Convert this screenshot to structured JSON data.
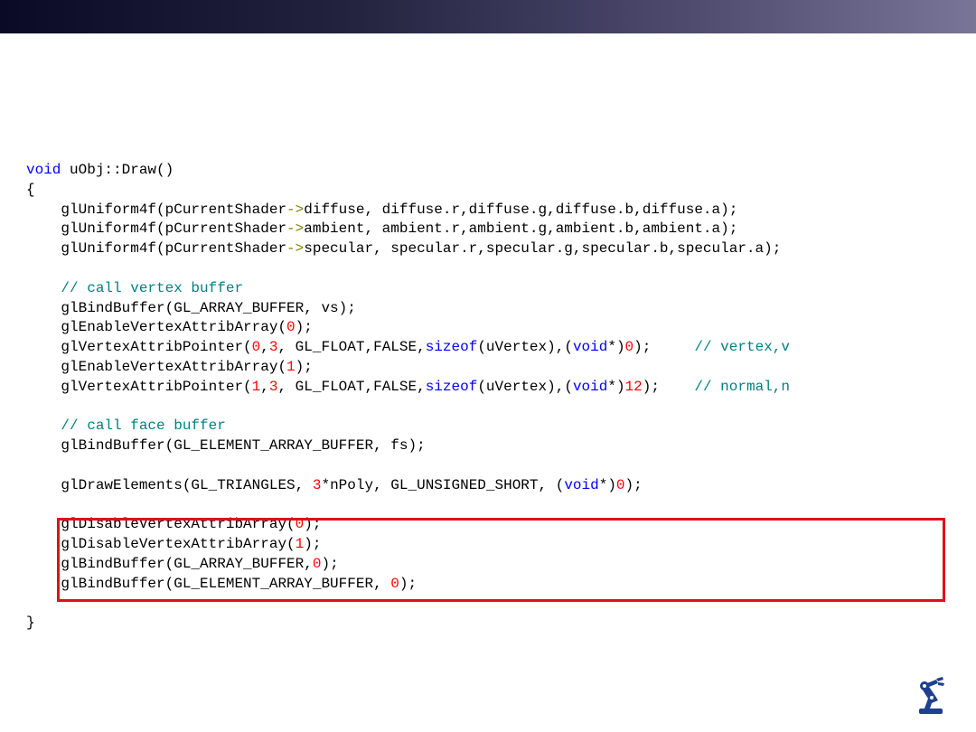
{
  "slide": {
    "colors": {
      "title_bar_start": "#0a0a26",
      "title_bar_end": "#787597",
      "highlight": "#e0101a"
    },
    "logo_icon": "robot-arm-icon"
  },
  "code": {
    "lines": [
      [
        {
          "t": "void",
          "c": "kw"
        },
        {
          "t": " uObj::Draw()"
        }
      ],
      [
        {
          "t": "{"
        }
      ],
      [
        {
          "t": "    glUniform4f(pCurrentShader"
        },
        {
          "t": "->",
          "c": "op"
        },
        {
          "t": "diffuse, diffuse.r,diffuse.g,diffuse.b,diffuse.a);"
        }
      ],
      [
        {
          "t": "    glUniform4f(pCurrentShader"
        },
        {
          "t": "->",
          "c": "op"
        },
        {
          "t": "ambient, ambient.r,ambient.g,ambient.b,ambient.a);"
        }
      ],
      [
        {
          "t": "    glUniform4f(pCurrentShader"
        },
        {
          "t": "->",
          "c": "op"
        },
        {
          "t": "specular, specular.r,specular.g,specular.b,specular.a);"
        }
      ],
      [],
      [
        {
          "t": "    "
        },
        {
          "t": "// call vertex buffer",
          "c": "cm"
        }
      ],
      [
        {
          "t": "    glBindBuffer(GL_ARRAY_BUFFER, vs);"
        }
      ],
      [
        {
          "t": "    glEnableVertexAttribArray("
        },
        {
          "t": "0",
          "c": "num"
        },
        {
          "t": ");"
        }
      ],
      [
        {
          "t": "    glVertexAttribPointer("
        },
        {
          "t": "0",
          "c": "num"
        },
        {
          "t": ","
        },
        {
          "t": "3",
          "c": "num"
        },
        {
          "t": ", GL_FLOAT,FALSE,"
        },
        {
          "t": "sizeof",
          "c": "kw"
        },
        {
          "t": "(uVertex),("
        },
        {
          "t": "void",
          "c": "kw"
        },
        {
          "t": "*)"
        },
        {
          "t": "0",
          "c": "num"
        },
        {
          "t": ");     "
        },
        {
          "t": "// vertex,v",
          "c": "cm"
        }
      ],
      [
        {
          "t": "    glEnableVertexAttribArray("
        },
        {
          "t": "1",
          "c": "num"
        },
        {
          "t": ");"
        }
      ],
      [
        {
          "t": "    glVertexAttribPointer("
        },
        {
          "t": "1",
          "c": "num"
        },
        {
          "t": ","
        },
        {
          "t": "3",
          "c": "num"
        },
        {
          "t": ", GL_FLOAT,FALSE,"
        },
        {
          "t": "sizeof",
          "c": "kw"
        },
        {
          "t": "(uVertex),("
        },
        {
          "t": "void",
          "c": "kw"
        },
        {
          "t": "*)"
        },
        {
          "t": "12",
          "c": "num"
        },
        {
          "t": ");    "
        },
        {
          "t": "// normal,n",
          "c": "cm"
        }
      ],
      [],
      [
        {
          "t": "    "
        },
        {
          "t": "// call face buffer",
          "c": "cm"
        }
      ],
      [
        {
          "t": "    glBindBuffer(GL_ELEMENT_ARRAY_BUFFER, fs);"
        }
      ],
      [],
      [
        {
          "t": "    glDrawElements(GL_TRIANGLES, "
        },
        {
          "t": "3",
          "c": "num"
        },
        {
          "t": "*nPoly, GL_UNSIGNED_SHORT, ("
        },
        {
          "t": "void",
          "c": "kw"
        },
        {
          "t": "*)"
        },
        {
          "t": "0",
          "c": "num"
        },
        {
          "t": ");"
        }
      ],
      [],
      [
        {
          "t": "    glDisableVertexAttribArray("
        },
        {
          "t": "0",
          "c": "num"
        },
        {
          "t": ");"
        }
      ],
      [
        {
          "t": "    glDisableVertexAttribArray("
        },
        {
          "t": "1",
          "c": "num"
        },
        {
          "t": ");"
        }
      ],
      [
        {
          "t": "    glBindBuffer(GL_ARRAY_BUFFER,"
        },
        {
          "t": "0",
          "c": "num"
        },
        {
          "t": ");"
        }
      ],
      [
        {
          "t": "    glBindBuffer(GL_ELEMENT_ARRAY_BUFFER, "
        },
        {
          "t": "0",
          "c": "num"
        },
        {
          "t": ");"
        }
      ],
      [],
      [
        {
          "t": "}"
        }
      ]
    ]
  }
}
